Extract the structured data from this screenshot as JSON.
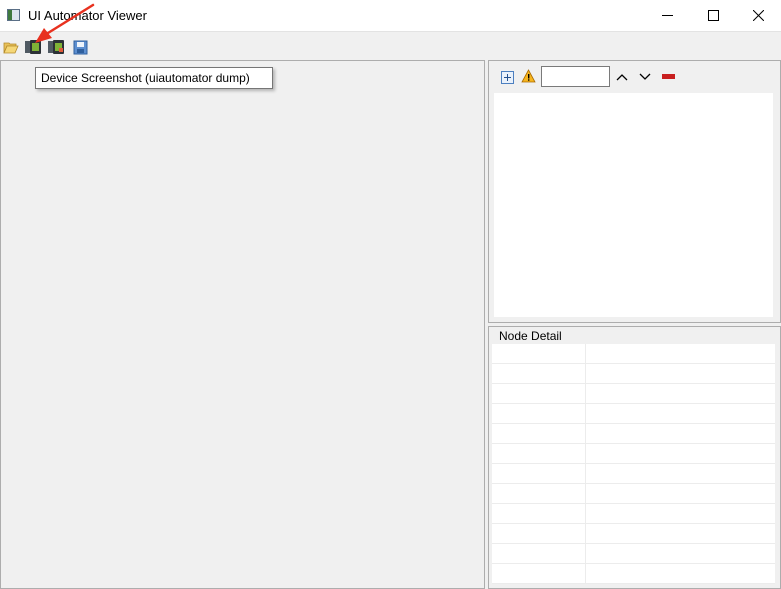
{
  "window": {
    "title": "UI Automator Viewer",
    "minimize_icon": "minimize-icon",
    "maximize_icon": "maximize-icon",
    "close_icon": "close-icon"
  },
  "toolbar": {
    "buttons": [
      {
        "icon": "folder-open-icon"
      },
      {
        "icon": "device-screenshot-icon"
      },
      {
        "icon": "device-screenshot-compressed-icon"
      },
      {
        "icon": "save-icon"
      }
    ]
  },
  "tooltip": {
    "text": "Device Screenshot (uiautomator dump)"
  },
  "hierarchy_toolbar": {
    "buttons": [
      {
        "icon": "expand-all-icon"
      },
      {
        "icon": "warning-icon"
      },
      {
        "icon": "chevron-up-icon"
      },
      {
        "icon": "chevron-down-icon"
      },
      {
        "icon": "clear-icon"
      }
    ],
    "search_value": ""
  },
  "node_detail": {
    "title": "Node Detail",
    "rows": [
      "",
      "",
      "",
      "",
      "",
      "",
      "",
      "",
      "",
      "",
      "",
      ""
    ]
  },
  "annotation": {
    "arrow_color": "#e8311f"
  }
}
